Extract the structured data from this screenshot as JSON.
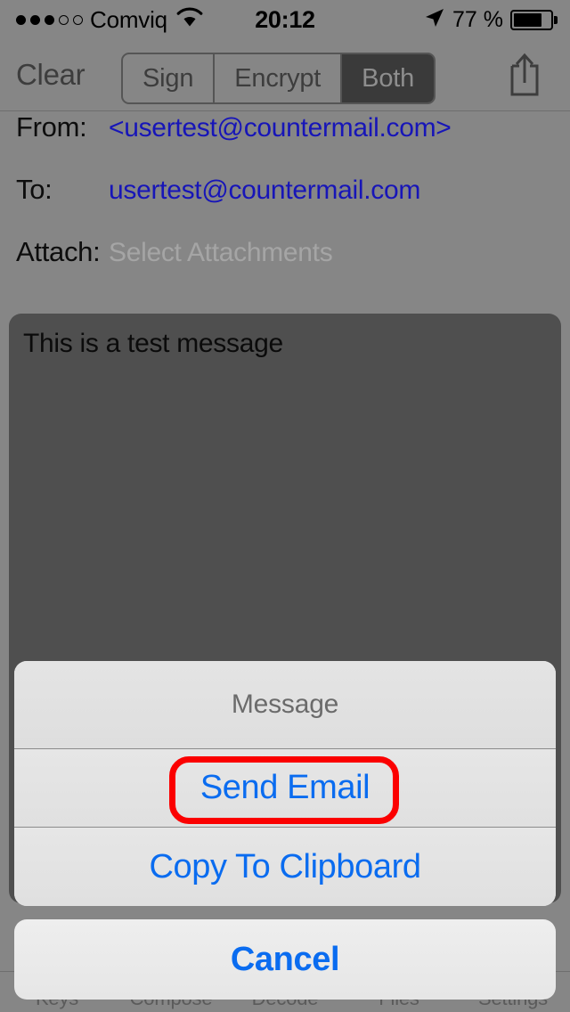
{
  "status_bar": {
    "signal_dots_filled": 3,
    "signal_dots_empty": 2,
    "carrier": "Comviq",
    "wifi_icon": "wifi-icon",
    "time": "20:12",
    "location_icon": "location-arrow-icon",
    "battery_percent": "77 %",
    "battery_level": 77
  },
  "toolbar": {
    "clear_label": "Clear",
    "segments": [
      {
        "label": "Sign",
        "selected": false
      },
      {
        "label": "Encrypt",
        "selected": false
      },
      {
        "label": "Both",
        "selected": true
      }
    ],
    "share_icon": "share-icon"
  },
  "compose": {
    "fields": [
      {
        "label": "From:",
        "value": "<usertest@countermail.com>",
        "is_placeholder": false
      },
      {
        "label": "To:",
        "value": "usertest@countermail.com",
        "is_placeholder": false
      },
      {
        "label": "Attach:",
        "value": "Select Attachments",
        "is_placeholder": true
      }
    ],
    "body_text": "This is a test message"
  },
  "action_sheet": {
    "title": "Message",
    "actions": [
      {
        "label": "Send Email",
        "highlighted": true
      },
      {
        "label": "Copy To Clipboard",
        "highlighted": false
      }
    ],
    "cancel_label": "Cancel"
  },
  "tab_bar": {
    "tabs": [
      {
        "label": "Keys"
      },
      {
        "label": "Compose"
      },
      {
        "label": "Decode"
      },
      {
        "label": "Files"
      },
      {
        "label": "Settings"
      }
    ]
  },
  "colors": {
    "background_dim": "#868686",
    "body_field": "#4f4f4f",
    "link_blue": "#0a6cf0",
    "email_blue": "#1715b8",
    "highlight_red": "#fb0000",
    "sheet_bg": "#e2e2e2",
    "segment_selected": "#3a3a3a"
  }
}
